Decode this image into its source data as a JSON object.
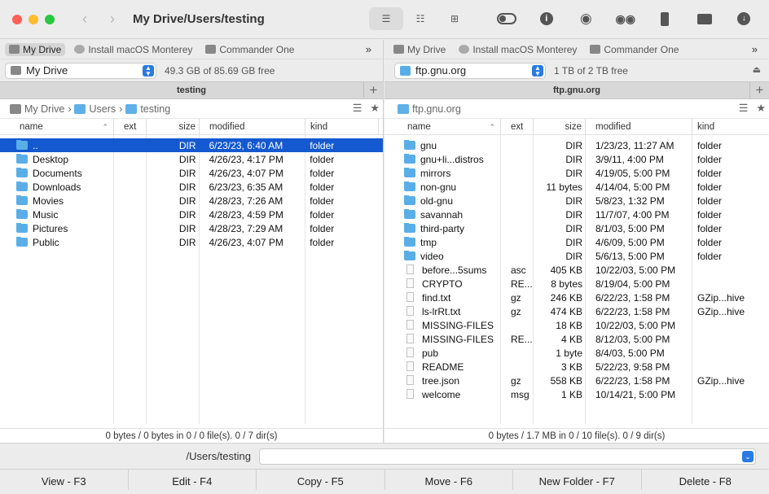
{
  "window": {
    "title": "My Drive/Users/testing",
    "traffic_colors": [
      "#ff5f57",
      "#febc2e",
      "#28c840"
    ]
  },
  "toolbar": {
    "view_icons": [
      "list-view-icon",
      "detail-view-icon",
      "grid-view-icon"
    ],
    "right_icons": [
      "toggle-hidden-icon",
      "info-icon",
      "preview-icon",
      "binoculars-icon",
      "archive-icon",
      "network-icon",
      "download-icon"
    ]
  },
  "left": {
    "drive_tabs": [
      {
        "label": "My Drive",
        "active": true
      },
      {
        "label": "Install macOS Monterey",
        "active": false
      },
      {
        "label": "Commander One",
        "active": false
      }
    ],
    "drive_select": "My Drive",
    "free_space": "49.3 GB of 85.69 GB free",
    "tab_title": "testing",
    "path": [
      "My Drive",
      "Users",
      "testing"
    ],
    "columns": [
      "name",
      "ext",
      "size",
      "modified",
      "kind"
    ],
    "rows": [
      {
        "name": "..",
        "ext": "",
        "size": "DIR",
        "modified": "6/23/23, 6:40 AM",
        "kind": "folder",
        "type": "folder",
        "selected": true
      },
      {
        "name": "Desktop",
        "ext": "",
        "size": "DIR",
        "modified": "4/26/23, 4:17 PM",
        "kind": "folder",
        "type": "folder"
      },
      {
        "name": "Documents",
        "ext": "",
        "size": "DIR",
        "modified": "4/26/23, 4:07 PM",
        "kind": "folder",
        "type": "folder"
      },
      {
        "name": "Downloads",
        "ext": "",
        "size": "DIR",
        "modified": "6/23/23, 6:35 AM",
        "kind": "folder",
        "type": "folder"
      },
      {
        "name": "Movies",
        "ext": "",
        "size": "DIR",
        "modified": "4/28/23, 7:26 AM",
        "kind": "folder",
        "type": "folder"
      },
      {
        "name": "Music",
        "ext": "",
        "size": "DIR",
        "modified": "4/28/23, 4:59 PM",
        "kind": "folder",
        "type": "folder"
      },
      {
        "name": "Pictures",
        "ext": "",
        "size": "DIR",
        "modified": "4/28/23, 7:29 AM",
        "kind": "folder",
        "type": "folder"
      },
      {
        "name": "Public",
        "ext": "",
        "size": "DIR",
        "modified": "4/26/23, 4:07 PM",
        "kind": "folder",
        "type": "folder"
      }
    ],
    "status": "0 bytes / 0 bytes in 0 / 0 file(s). 0 / 7 dir(s)"
  },
  "right": {
    "drive_tabs": [
      {
        "label": "My Drive",
        "active": false
      },
      {
        "label": "Install macOS Monterey",
        "active": false
      },
      {
        "label": "Commander One",
        "active": false
      }
    ],
    "drive_select": "ftp.gnu.org",
    "free_space": "1 TB of 2 TB free",
    "tab_title": "ftp.gnu.org",
    "path": [
      "ftp.gnu.org"
    ],
    "columns": [
      "name",
      "ext",
      "size",
      "modified",
      "kind"
    ],
    "rows": [
      {
        "name": "gnu",
        "ext": "",
        "size": "DIR",
        "modified": "1/23/23, 11:27 AM",
        "kind": "folder",
        "type": "folder"
      },
      {
        "name": "gnu+li...distros",
        "ext": "",
        "size": "DIR",
        "modified": "3/9/11, 4:00 PM",
        "kind": "folder",
        "type": "folder"
      },
      {
        "name": "mirrors",
        "ext": "",
        "size": "DIR",
        "modified": "4/19/05, 5:00 PM",
        "kind": "folder",
        "type": "folder"
      },
      {
        "name": "non-gnu",
        "ext": "",
        "size": "11 bytes",
        "modified": "4/14/04, 5:00 PM",
        "kind": "folder",
        "type": "folder"
      },
      {
        "name": "old-gnu",
        "ext": "",
        "size": "DIR",
        "modified": "5/8/23, 1:32 PM",
        "kind": "folder",
        "type": "folder"
      },
      {
        "name": "savannah",
        "ext": "",
        "size": "DIR",
        "modified": "11/7/07, 4:00 PM",
        "kind": "folder",
        "type": "folder"
      },
      {
        "name": "third-party",
        "ext": "",
        "size": "DIR",
        "modified": "8/1/03, 5:00 PM",
        "kind": "folder",
        "type": "folder"
      },
      {
        "name": "tmp",
        "ext": "",
        "size": "DIR",
        "modified": "4/6/09, 5:00 PM",
        "kind": "folder",
        "type": "folder"
      },
      {
        "name": "video",
        "ext": "",
        "size": "DIR",
        "modified": "5/6/13, 5:00 PM",
        "kind": "folder",
        "type": "folder"
      },
      {
        "name": "before...5sums",
        "ext": "asc",
        "size": "405 KB",
        "modified": "10/22/03, 5:00 PM",
        "kind": "",
        "type": "file"
      },
      {
        "name": "CRYPTO",
        "ext": "RE...",
        "size": "8 bytes",
        "modified": "8/19/04, 5:00 PM",
        "kind": "",
        "type": "file"
      },
      {
        "name": "find.txt",
        "ext": "gz",
        "size": "246 KB",
        "modified": "6/22/23, 1:58 PM",
        "kind": "GZip...hive",
        "type": "file"
      },
      {
        "name": "ls-lrRt.txt",
        "ext": "gz",
        "size": "474 KB",
        "modified": "6/22/23, 1:58 PM",
        "kind": "GZip...hive",
        "type": "file"
      },
      {
        "name": "MISSING-FILES",
        "ext": "",
        "size": "18 KB",
        "modified": "10/22/03, 5:00 PM",
        "kind": "",
        "type": "file"
      },
      {
        "name": "MISSING-FILES",
        "ext": "RE...",
        "size": "4 KB",
        "modified": "8/12/03, 5:00 PM",
        "kind": "",
        "type": "file"
      },
      {
        "name": "pub",
        "ext": "",
        "size": "1 byte",
        "modified": "8/4/03, 5:00 PM",
        "kind": "",
        "type": "file"
      },
      {
        "name": "README",
        "ext": "",
        "size": "3 KB",
        "modified": "5/22/23, 9:58 PM",
        "kind": "",
        "type": "file"
      },
      {
        "name": "tree.json",
        "ext": "gz",
        "size": "558 KB",
        "modified": "6/22/23, 1:58 PM",
        "kind": "GZip...hive",
        "type": "file"
      },
      {
        "name": "welcome",
        "ext": "msg",
        "size": "1 KB",
        "modified": "10/14/21, 5:00 PM",
        "kind": "",
        "type": "file"
      }
    ],
    "status": "0 bytes / 1.7 MB in 0 / 10 file(s). 0 / 9 dir(s)"
  },
  "command": {
    "label": "/Users/testing",
    "value": ""
  },
  "fkeys": [
    "View - F3",
    "Edit - F4",
    "Copy - F5",
    "Move - F6",
    "New Folder - F7",
    "Delete - F8"
  ]
}
